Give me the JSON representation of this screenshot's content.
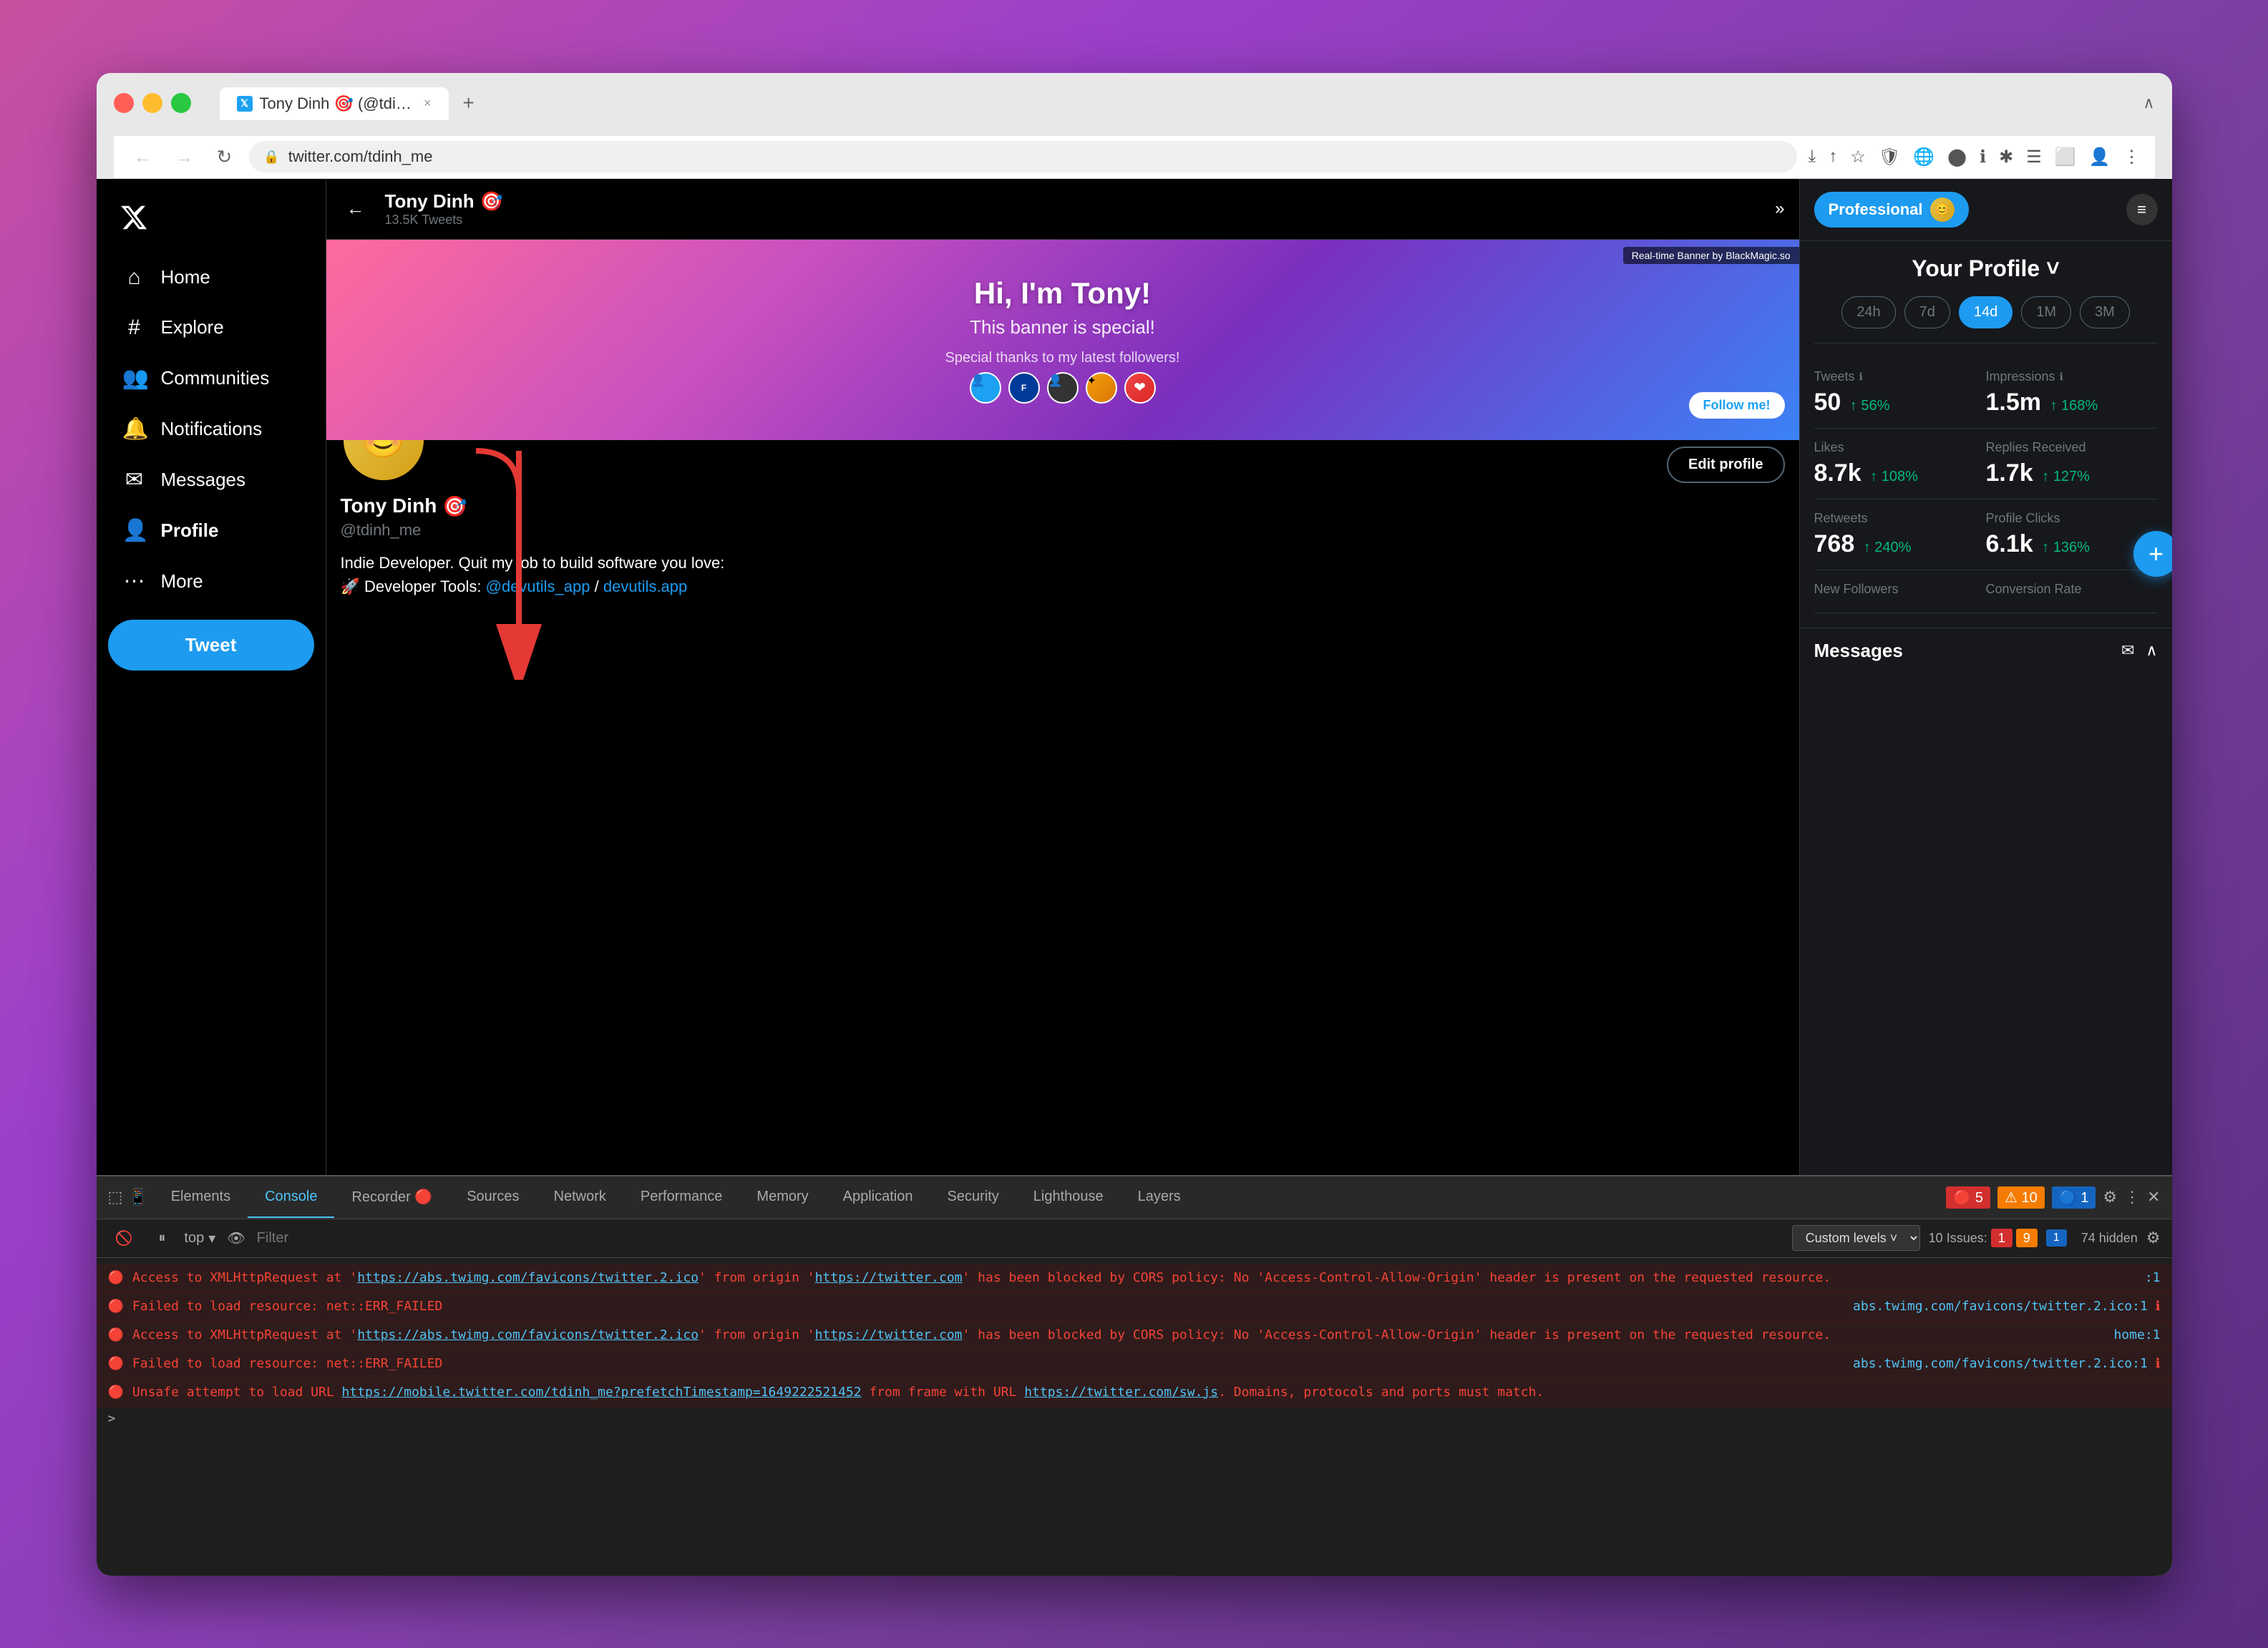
{
  "browser": {
    "tab_title": "Tony Dinh 🎯 (@tdinh_me) / Tw",
    "tab_close": "×",
    "tab_new": "+",
    "url": "twitter.com/tdinh_me",
    "nav": {
      "back": "←",
      "forward": "→",
      "reload": "↻"
    },
    "toolbar": [
      "⤓",
      "↑",
      "☆",
      "🛡",
      "🌐",
      "⬤",
      "ℹ",
      "✱",
      "☰",
      "⬜",
      "👤",
      "⋮"
    ]
  },
  "sidebar": {
    "logo": "🐦",
    "items": [
      {
        "label": "Home",
        "icon": "⌂"
      },
      {
        "label": "Explore",
        "icon": "#"
      },
      {
        "label": "Communities",
        "icon": "👥"
      },
      {
        "label": "Notifications",
        "icon": "🔔"
      },
      {
        "label": "Messages",
        "icon": "✉"
      },
      {
        "label": "Profile",
        "icon": "👤"
      },
      {
        "label": "More",
        "icon": "⋯"
      }
    ],
    "tweet_btn": "Tweet"
  },
  "profile_header": {
    "back": "←",
    "name": "Tony Dinh",
    "verified": "🎯",
    "tweets_count": "13.5K Tweets",
    "expand": "»"
  },
  "banner": {
    "realtime": "Real-time Banner by BlackMagic.so",
    "title": "Hi, I'm Tony!",
    "subtitle": "This banner is special!",
    "thanks": "Special thanks to my latest followers!",
    "follow_me": "Follow me!"
  },
  "profile": {
    "name": "Tony Dinh",
    "verified": "🎯",
    "handle": "@tdinh_me",
    "bio_line1": "Indie Developer. Quit my job to build software you love:",
    "bio_emoji": "🚀",
    "bio_line2": "Developer Tools:",
    "bio_link1": "@devutils_app",
    "bio_slash": " / ",
    "bio_link2": "devutils.app",
    "edit_btn": "Edit profile"
  },
  "right_panel": {
    "professional": "Professional",
    "menu": "≡",
    "your_profile": "Your Profile ˅",
    "time_filters": [
      "24h",
      "7d",
      "14d",
      "1M",
      "3M"
    ],
    "active_filter": "14d",
    "stats": [
      {
        "label": "Tweets",
        "value": "50",
        "change": "56%",
        "has_info": true
      },
      {
        "label": "Impressions",
        "value": "1.5m",
        "change": "168%",
        "has_info": true
      },
      {
        "label": "Likes",
        "value": "8.7k",
        "change": "108%",
        "has_info": false
      },
      {
        "label": "Replies Received",
        "value": "1.7k",
        "change": "127%",
        "has_info": false
      },
      {
        "label": "Retweets",
        "value": "768",
        "change": "240%",
        "has_info": false
      },
      {
        "label": "Profile Clicks",
        "value": "6.1k",
        "change": "136%",
        "has_info": false
      },
      {
        "label": "New Followers",
        "value": "",
        "change": "",
        "has_info": false
      },
      {
        "label": "Conversion Rate",
        "value": "",
        "change": "",
        "has_info": false
      }
    ],
    "messages_title": "Messages",
    "messages_icons": [
      "✉",
      "∧"
    ]
  },
  "devtools": {
    "tabs": [
      "Elements",
      "Console",
      "Recorder 🔴",
      "Sources",
      "Network",
      "Performance",
      "Memory",
      "Application",
      "Security",
      "Lighthouse",
      "Layers"
    ],
    "active_tab": "Console",
    "filter_placeholder": "Filter",
    "custom_levels": "Custom levels ˅",
    "issues_count": "10 Issues:",
    "issues_red": "1",
    "issues_yellow": "9",
    "issues_blue": "1",
    "hidden": "74 hidden",
    "filter_options": "top",
    "console_lines": [
      {
        "type": "error",
        "text": "Access to XMLHttpRequest at 'https://abs.twimg.com/favicons/twitter.2.ico' from origin 'https://twitter.com' has been blocked by CORS policy: No 'Access-Control-Allow-Origin' header is present",
        "link1": "https://abs.twimg.com/favicons/twitter.2.ico",
        "link2": "https://twitter.com",
        "source": ":1"
      },
      {
        "type": "error",
        "text": "Failed to load resource: net::ERR_FAILED",
        "source": "abs.twimg.com/favicons/twitter.2.ico:1"
      },
      {
        "type": "error",
        "text": "Access to XMLHttpRequest at 'https://abs.twimg.com/favicons/twitter.2.ico' from origin 'https://twitter.com' has been blocked by CORS policy: No 'Access-Control-Allow-Origin' header is present on the requested resource.",
        "link1": "https://abs.twimg.com/favicons/twitter.2.ico",
        "link2": "https://twitter.com",
        "source": "home:1"
      },
      {
        "type": "error",
        "text": "Failed to load resource: net::ERR_FAILED",
        "source": "abs.twimg.com/favicons/twitter.2.ico:1"
      },
      {
        "type": "error",
        "text": "Unsafe attempt to load URL https://mobile.twitter.com/tdinh_me?prefetchTimestamp=1649222521452 from frame with URL https://twitter.com/sw.js. Domains, protocols and ports must match.",
        "source": ""
      }
    ],
    "cursor": ">"
  }
}
